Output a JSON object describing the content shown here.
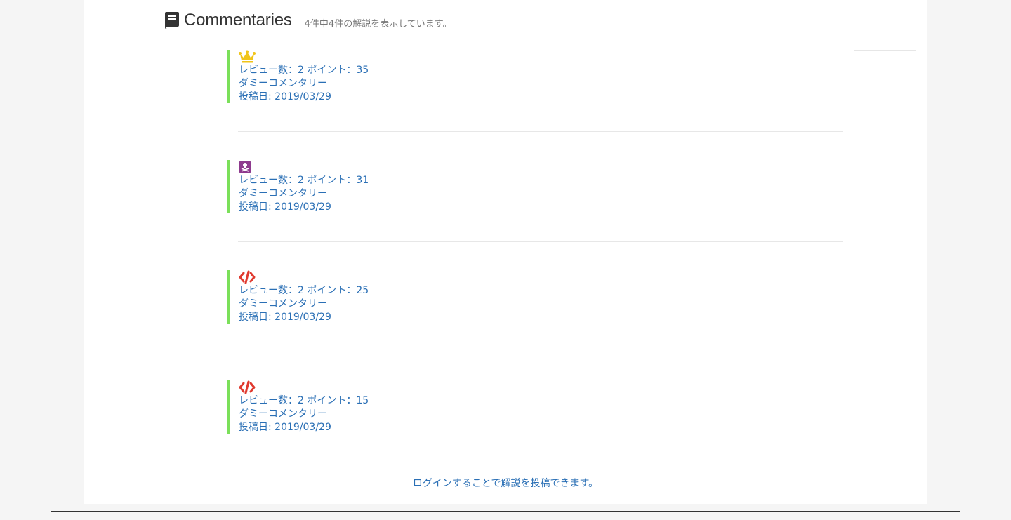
{
  "header": {
    "title": "Commentaries",
    "subtitle": "4件中4件の解説を表示しています。"
  },
  "entries": [
    {
      "icon": "crown-icon",
      "icon_color": "#f0c419",
      "reviews": "レビュー数：2 ポイント：35",
      "comment": "ダミーコメンタリー",
      "date": "投稿日: 2019/03/29"
    },
    {
      "icon": "book-skull-icon",
      "icon_color": "#8e3a8e",
      "reviews": "レビュー数：2 ポイント：31",
      "comment": "ダミーコメンタリー",
      "date": "投稿日: 2019/03/29"
    },
    {
      "icon": "code-icon",
      "icon_color": "#e03a2f",
      "reviews": "レビュー数：2 ポイント：25",
      "comment": "ダミーコメンタリー",
      "date": "投稿日: 2019/03/29"
    },
    {
      "icon": "code-icon",
      "icon_color": "#e03a2f",
      "reviews": "レビュー数：2 ポイント：15",
      "comment": "ダミーコメンタリー",
      "date": "投稿日: 2019/03/29"
    }
  ],
  "login_note": "ログインすることで解説を投稿できます。",
  "colors": {
    "accent_border": "#7be05a",
    "link": "#2a6fb5"
  }
}
